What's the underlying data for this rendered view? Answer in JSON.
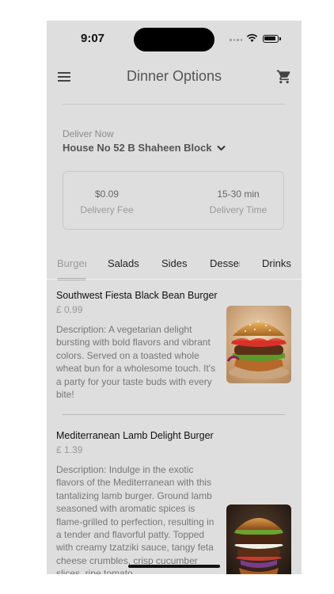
{
  "status": {
    "time": "9:07"
  },
  "header": {
    "title": "Dinner Options"
  },
  "delivery": {
    "label": "Deliver Now",
    "address": "House No 52 B Shaheen Block",
    "fee_value": "$0.09",
    "fee_label": "Delivery Fee",
    "time_value": "15-30 min",
    "time_label": "Delivery Time"
  },
  "tabs": [
    {
      "label": "Burgers",
      "active": true
    },
    {
      "label": "Salads"
    },
    {
      "label": "Sides"
    },
    {
      "label": "Desserts"
    },
    {
      "label": "Drinks"
    }
  ],
  "items": [
    {
      "name": "Southwest Fiesta Black Bean Burger",
      "price": "£ 0.99",
      "description": "Description: A vegetarian delight bursting with bold flavors and vibrant colors. Served on a toasted whole wheat bun for a wholesome touch. It's a party for your taste buds with every bite!"
    },
    {
      "name": "Mediterranean Lamb Delight Burger",
      "price": "£ 1.39",
      "description": "Description: Indulge in the exotic flavors of the Mediterranean with this tantalizing lamb burger. Ground lamb seasoned with aromatic spices is flame-grilled to perfection, resulting in a tender and flavorful patty. Topped with creamy tzatziki sauce, tangy feta cheese crumbles, crisp cucumber slices, ripe tomato"
    }
  ]
}
